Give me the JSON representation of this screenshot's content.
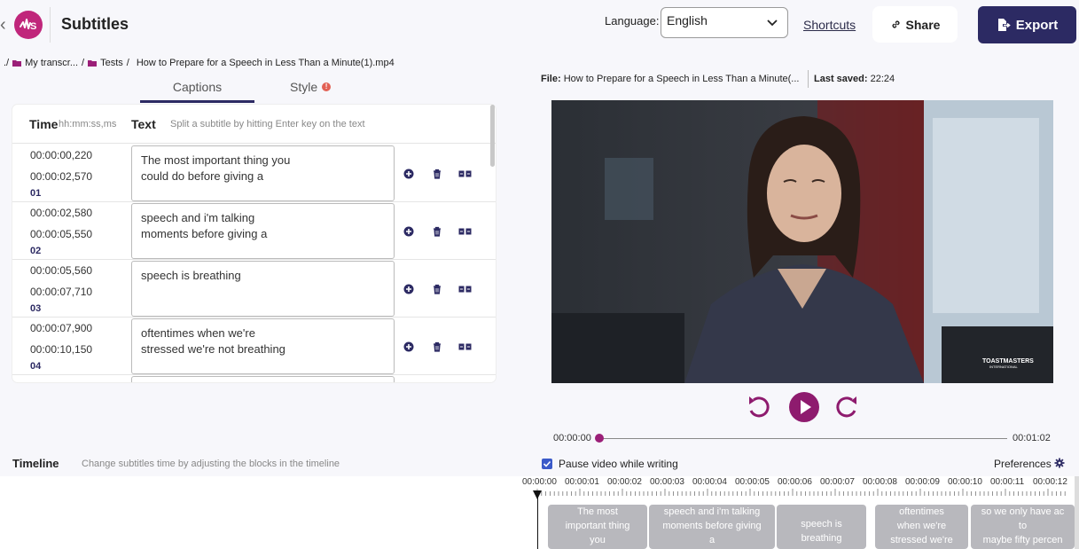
{
  "header": {
    "title": "Subtitles",
    "language_label": "Language:",
    "language_value": "English",
    "shortcuts": "Shortcuts",
    "share": "Share",
    "export": "Export"
  },
  "breadcrumb": {
    "root": "./",
    "folder1": "My transcr...",
    "sep1": "/",
    "folder2": "Tests",
    "sep2": "/",
    "file": "How to Prepare for a Speech in Less Than a Minute(1).mp4"
  },
  "tabs": {
    "captions": "Captions",
    "style": "Style"
  },
  "caption_table": {
    "time_header": "Time",
    "time_format": "hh:mm:ss,ms",
    "text_header": "Text",
    "text_hint": "Split a subtitle by hitting Enter key on the text",
    "rows": [
      {
        "start": "00:00:00,220",
        "end": "00:00:02,570",
        "num": "01",
        "text": "The most important thing you\ncould do before giving a"
      },
      {
        "start": "00:00:02,580",
        "end": "00:00:05,550",
        "num": "02",
        "text": "speech and i'm talking\nmoments before giving a"
      },
      {
        "start": "00:00:05,560",
        "end": "00:00:07,710",
        "num": "03",
        "text": "speech is breathing"
      },
      {
        "start": "00:00:07,900",
        "end": "00:00:10,150",
        "num": "04",
        "text": "oftentimes when we're\nstressed we're not breathing"
      }
    ]
  },
  "video": {
    "file_label": "File:",
    "file_name": "How to Prepare for a Speech in Less Than a Minute(...",
    "saved_label": "Last saved:",
    "saved_time": "22:24",
    "watermark": "TOASTMASTERS",
    "watermark_sub": "INTERNATIONAL",
    "current_time": "00:00:00",
    "duration": "00:01:02",
    "progress": 0
  },
  "timeline": {
    "title": "Timeline",
    "hint": "Change subtitles time by adjusting the blocks in the timeline",
    "pause_label": "Pause video while writing",
    "pause_checked": true,
    "preferences": "Preferences",
    "ticks": [
      "00:00:00",
      "00:00:01",
      "00:00:02",
      "00:00:03",
      "00:00:04",
      "00:00:05",
      "00:00:06",
      "00:00:07",
      "00:00:08",
      "00:00:09",
      "00:00:10",
      "00:00:11",
      "00:00:12"
    ],
    "blocks": [
      "The most\nimportant thing\nyou",
      "speech and i'm talking\nmoments before giving\na",
      "speech is\nbreathing",
      "oftentimes\nwhen we're\nstressed we're",
      "so we only have ac\nto\nmaybe fifty percen"
    ]
  },
  "colors": {
    "brand": "#2c2a63",
    "accent": "#9b1f78",
    "logo": "#c0267b"
  }
}
